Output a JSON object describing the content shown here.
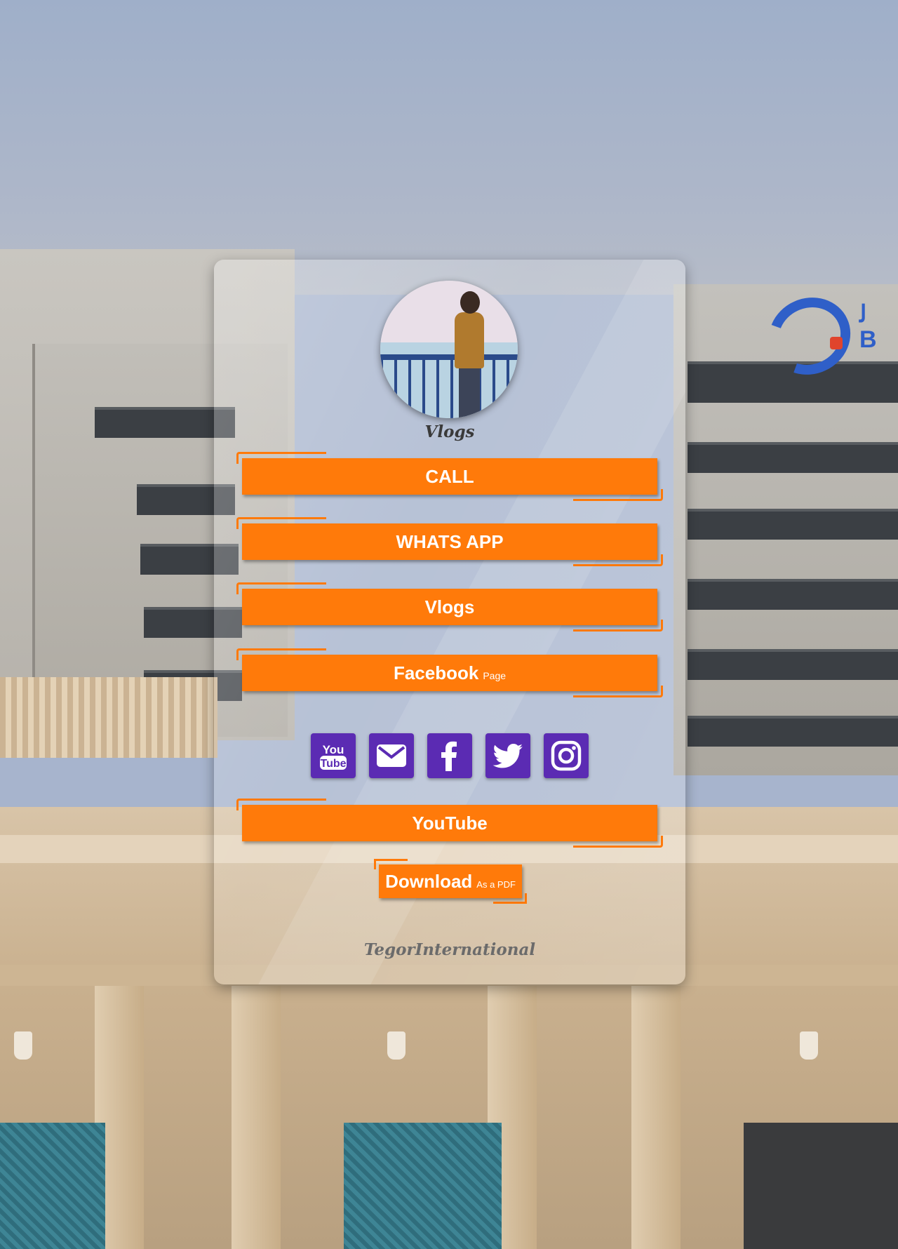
{
  "profile": {
    "name": "Vlogs"
  },
  "buttons": {
    "call": "CALL",
    "whatsapp": "WHATS APP",
    "vlogs": "Vlogs",
    "facebook": "Facebook",
    "facebook_sub": "Page",
    "youtube": "YouTube",
    "download": "Download",
    "download_sub": "As a PDF"
  },
  "socials": [
    "youtube-icon",
    "mail-icon",
    "facebook-icon",
    "twitter-icon",
    "instagram-icon"
  ],
  "footer": {
    "brand": "TegorInternational"
  },
  "colors": {
    "accent": "#ff7a0a",
    "social_bg": "#5b2bb3"
  }
}
